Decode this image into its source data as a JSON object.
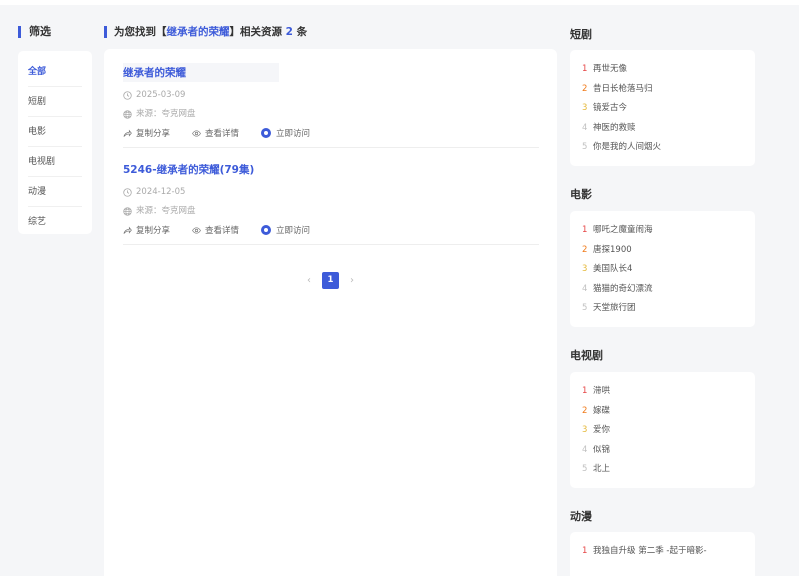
{
  "filter": {
    "title": "筛选",
    "items": [
      {
        "label": "全部",
        "active": true
      },
      {
        "label": "短剧",
        "active": false
      },
      {
        "label": "电影",
        "active": false
      },
      {
        "label": "电视剧",
        "active": false
      },
      {
        "label": "动漫",
        "active": false
      },
      {
        "label": "综艺",
        "active": false
      }
    ]
  },
  "results": {
    "header_prefix": "为您找到【",
    "keyword": "继承者的荣耀",
    "header_mid": "】相关资源 ",
    "count": "2",
    "header_suffix": " 条",
    "items": [
      {
        "title": "继承者的荣耀",
        "date": "2025-03-09",
        "source": "来源：夸克网盘",
        "share": "复制分享",
        "details": "查看详情",
        "visit": "立即访问"
      },
      {
        "title": "5246-继承者的荣耀(79集)",
        "date": "2024-12-05",
        "source": "来源：夸克网盘",
        "share": "复制分享",
        "details": "查看详情",
        "visit": "立即访问"
      }
    ],
    "pagination": {
      "prev": "‹",
      "current": "1",
      "next": "›"
    }
  },
  "sidebar": {
    "short_drama": {
      "title": "短剧",
      "items": [
        "再世无像",
        "昔日长枪落马归",
        "镜爱古今",
        "神医的救赎",
        "你是我的人间烟火"
      ]
    },
    "movies": {
      "title": "电影",
      "items": [
        "哪吒之魔童闹海",
        "唐探1900",
        "美国队长4",
        "猫猫的奇幻漂流",
        "天堂旅行团"
      ]
    },
    "tv": {
      "title": "电视剧",
      "items": [
        "滞哄",
        "嫁碟",
        "爱你",
        "似锦",
        "北上"
      ]
    },
    "anime": {
      "title": "动漫",
      "items": [
        "我独自升级 第二季 -起于暗影-"
      ]
    }
  },
  "colors": {
    "accent": "#3d5bd9",
    "rank1": "#e64545",
    "rank2": "#f07a1a",
    "rank3": "#e5b83a",
    "rank_other": "#c0c0c0"
  },
  "icons": {
    "date": "clock-icon",
    "source": "globe-icon",
    "share": "share-icon",
    "details": "eye-icon",
    "visit": "ring-icon"
  }
}
